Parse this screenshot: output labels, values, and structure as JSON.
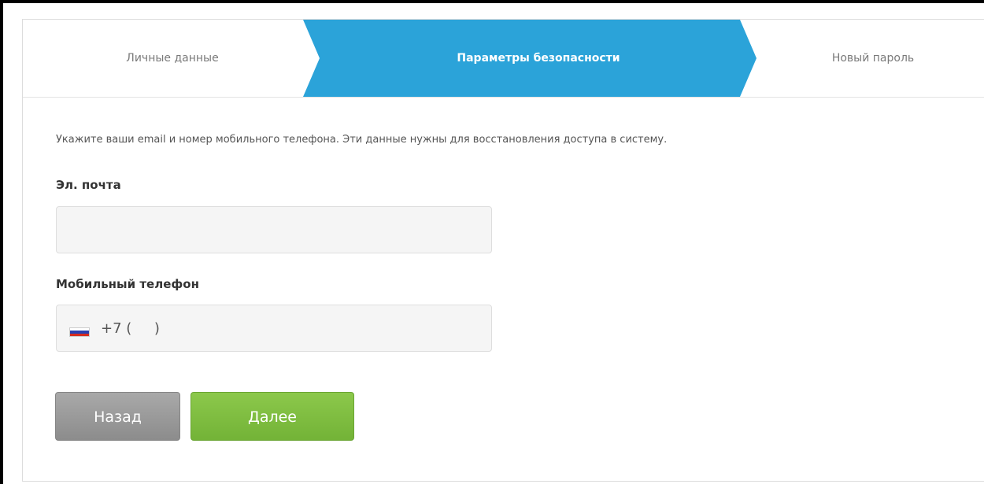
{
  "steps": [
    {
      "label": "Личные данные",
      "active": false
    },
    {
      "label": "Параметры безопасности",
      "active": true
    },
    {
      "label": "Новый пароль",
      "active": false
    }
  ],
  "intro_text": "Укажите ваши email и номер мобильного телефона. Эти данные нужны для восстановления доступа в систему.",
  "form": {
    "email": {
      "label": "Эл. почта",
      "value": ""
    },
    "phone": {
      "label": "Мобильный телефон",
      "value": "+7 (     )",
      "country_flag": "russia-flag-icon"
    }
  },
  "buttons": {
    "back_label": "Назад",
    "next_label": "Далее"
  },
  "colors": {
    "active_step": "#2ba3d9",
    "next_button": "#7dbc3f",
    "back_button": "#999999"
  }
}
